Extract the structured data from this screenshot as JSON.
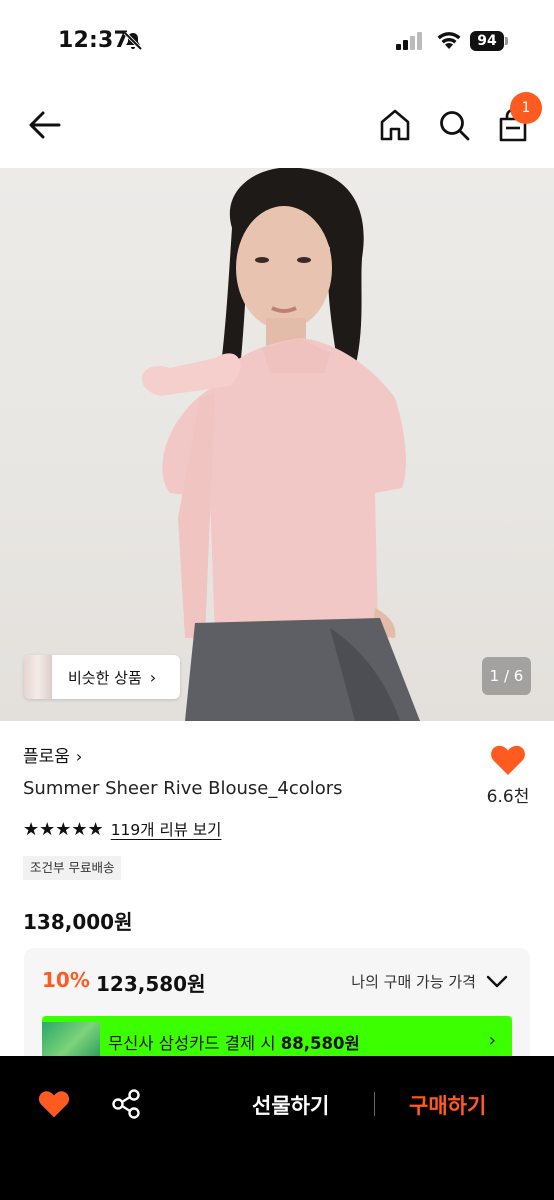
{
  "status_bar": {
    "time": "12:37",
    "battery": "94"
  },
  "nav": {
    "cart_count": "1"
  },
  "gallery": {
    "similar_label": "비슷한 상품",
    "indicator": "1 / 6"
  },
  "product": {
    "brand": "플로움",
    "name": "Summer Sheer Rive Blouse_4colors",
    "likes": "6.6천",
    "review_link": "119개 리뷰 보기",
    "rating_stars": 5,
    "shipping_tag": "조건부 무료배송",
    "original_price": "138,000원"
  },
  "price_box": {
    "discount": "10%",
    "sale_price": "123,580원",
    "my_price_label": "나의 구매 가능 가격",
    "card_banner_text": "무신사 삼성카드 결제 시",
    "card_banner_price": "88,580원"
  },
  "bottom_bar": {
    "gift_label": "선물하기",
    "buy_label": "구매하기"
  },
  "colors": {
    "accent": "#ff5a1f",
    "banner_green": "#3cff00",
    "bottom_bar": "#000000"
  },
  "icons": [
    "bell-slash-icon",
    "signal-icon",
    "wifi-icon",
    "back-arrow-icon",
    "home-icon",
    "search-icon",
    "cart-icon",
    "heart-icon",
    "share-icon",
    "chevron-right-icon",
    "chevron-down-icon"
  ]
}
